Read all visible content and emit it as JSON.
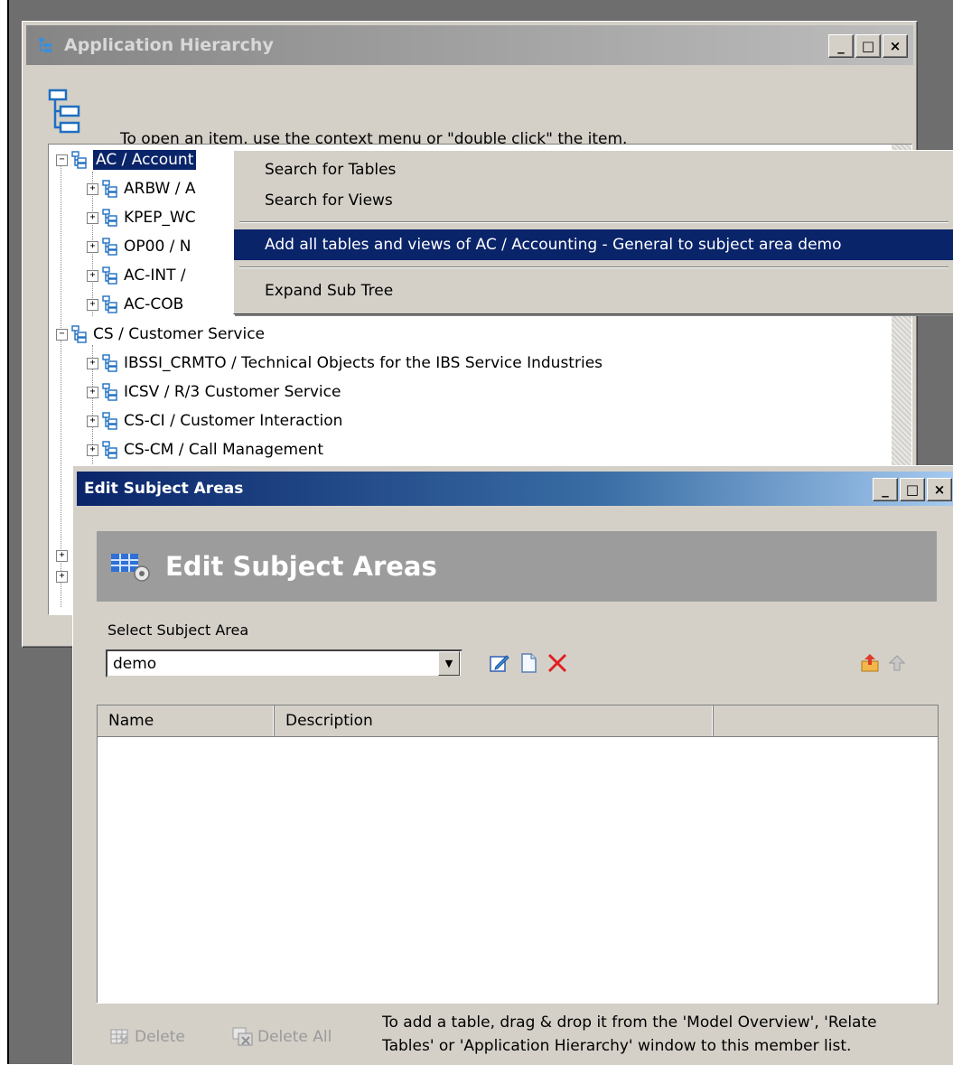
{
  "app_hierarchy": {
    "title": "Application Hierarchy",
    "hint": "To open an item, use the context menu or \"double click\" the item.",
    "tree": [
      {
        "label": "AC / Accounting - General",
        "visible": "AC / Account",
        "expanded": true,
        "selected": true
      },
      {
        "label": "ARBW / A",
        "indent": 1
      },
      {
        "label": "KPEP_WC",
        "indent": 1
      },
      {
        "label": "OP00 / N",
        "indent": 1
      },
      {
        "label": "AC-INT /",
        "indent": 1
      },
      {
        "label": "AC-COB",
        "indent": 1
      },
      {
        "label": "CS / Customer Service",
        "expanded": true
      },
      {
        "label": "IBSSI_CRMTO / Technical Objects for the IBS Service Industries",
        "indent": 1
      },
      {
        "label": "ICSV / R/3 Customer Service",
        "indent": 1
      },
      {
        "label": "CS-CI / Customer Interaction",
        "indent": 1
      },
      {
        "label": "CS-CM / Call Management",
        "indent": 1
      }
    ],
    "window_buttons": {
      "minimize": "_",
      "maximize": "□",
      "close": "×"
    }
  },
  "context_menu": {
    "items": [
      {
        "label": "Search for Tables"
      },
      {
        "label": "Search for Views"
      },
      {
        "label": "Add all tables and views of AC / Accounting - General to subject area demo",
        "highlighted": true
      },
      {
        "label": "Expand Sub Tree"
      }
    ]
  },
  "edit_subject_areas": {
    "title": "Edit Subject Areas",
    "banner": "Edit Subject Areas",
    "select_label": "Select Subject Area",
    "selected_area": "demo",
    "columns": [
      "Name",
      "Description"
    ],
    "rows": [],
    "footer": {
      "delete": "Delete",
      "delete_all": "Delete All",
      "note_line1": "To add a table, drag & drop it from the 'Model Overview', 'Relate",
      "note_line2": "Tables' or 'Application Hierarchy'  window to this member list."
    },
    "window_buttons": {
      "minimize": "_",
      "maximize": "□",
      "close": "×"
    }
  },
  "colors": {
    "selection": "#0a246a",
    "face": "#d4d0c8",
    "delete_icon": "#e02020"
  }
}
